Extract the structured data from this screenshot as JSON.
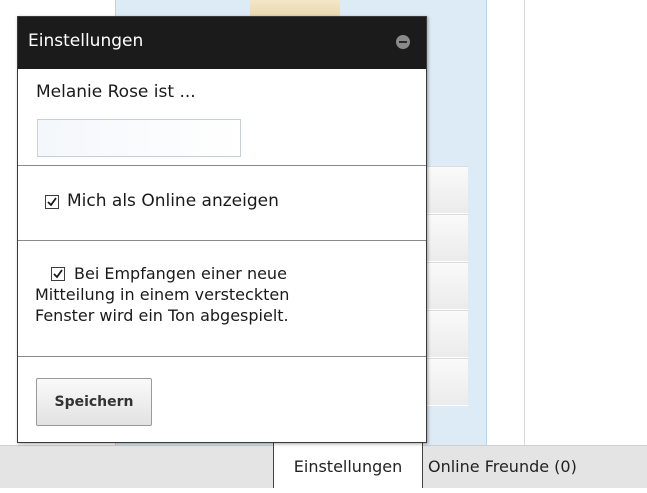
{
  "popup": {
    "title": "Einstellungen",
    "name_label": "Melanie Rose ist ...",
    "name_value": "",
    "show_online_label": "Mich als Online anzeigen",
    "show_online_checked": true,
    "sound_line1": "Bei Empfangen einer neue",
    "sound_line2": "Mitteilung in einem versteckten",
    "sound_line3": "Fenster wird ein Ton abgespielt.",
    "sound_checked": true,
    "save_label": "Speichern"
  },
  "bottom_bar": {
    "settings_tab": "Einstellungen",
    "friends_tab": "Online Freunde (0)"
  }
}
